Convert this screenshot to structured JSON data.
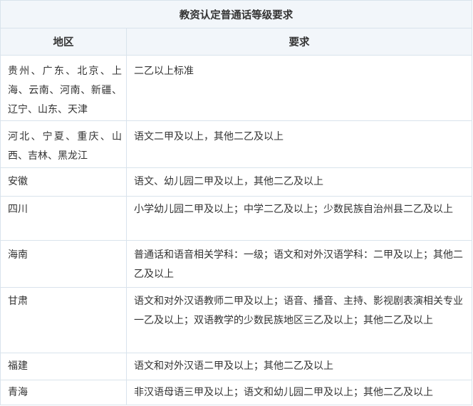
{
  "table": {
    "title": "教资认定普通话等级要求",
    "headers": {
      "region": "地区",
      "requirement": "要求"
    },
    "rows": [
      {
        "region": "贵州、广东、北京、上海、云南、河南、新疆、辽宁、山东、天津",
        "requirement": "二乙以上标准"
      },
      {
        "region": "河北、宁夏、重庆、山西、吉林、黑龙江",
        "requirement": "语文二甲及以上，其他二乙及以上"
      },
      {
        "region": "安徽",
        "requirement": "语文、幼儿园二甲及以上，其他二乙及以上"
      },
      {
        "region": "四川",
        "requirement": "小学幼儿园二甲及以上；中学二乙及以上；少数民族自治州县二乙及以上"
      },
      {
        "region": "海南",
        "requirement": "普通话和语音相关学科：一级；语文和对外汉语学科：二甲及以上；其他二乙及以上"
      },
      {
        "region": "甘肃",
        "requirement": "语文和对外汉语教师二甲及以上；语音、播音、主持、影视剧表演相关专业一乙及以上；双语教学的少数民族地区三乙及以上；其他二乙及以上"
      },
      {
        "region": "福建",
        "requirement": "语文和对外汉语二甲及以上；其他二乙及以上"
      },
      {
        "region": "青海",
        "requirement": "非汉语母语三甲及以上；语文和幼儿园二甲及以上；其他二乙及以上"
      }
    ]
  }
}
